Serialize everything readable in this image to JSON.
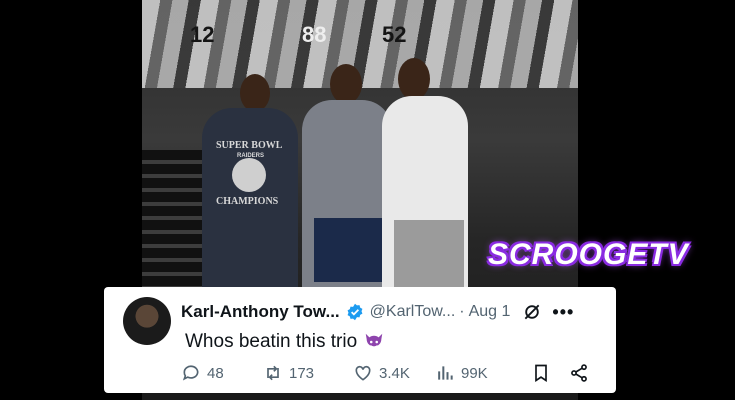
{
  "watermark": "SCROOGETV",
  "mural": {
    "numbers": [
      "12",
      "88",
      "52"
    ]
  },
  "shirt": {
    "line1": "SUPER BOWL",
    "line2": "RAIDERS",
    "line3": "CHAMPIONS"
  },
  "tweet": {
    "author_name": "Karl-Anthony Tow...",
    "verified": true,
    "handle": "@KarlTow...",
    "separator": "·",
    "date": "Aug 1",
    "text": "Whos beatin this trio",
    "emoji": "smiling-devil",
    "more": "•••",
    "stats": {
      "replies": "48",
      "reposts": "173",
      "likes": "3.4K",
      "views": "99K"
    }
  },
  "colors": {
    "verified": "#1d9bf0",
    "devil": "#8e44ad",
    "watermark_glow": "#8a2be2"
  }
}
